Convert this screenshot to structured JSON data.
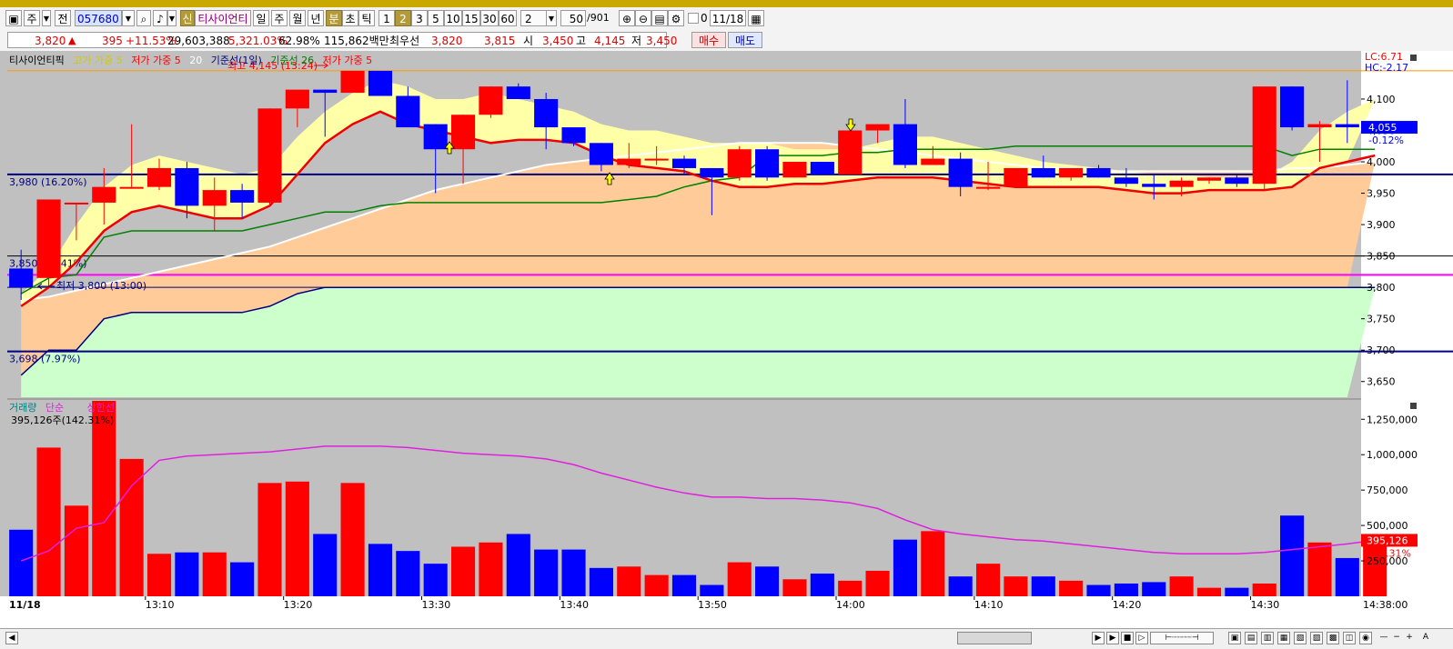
{
  "toolbar": {
    "period_label": "주",
    "prev_label": "전",
    "code": "057680",
    "new_badge": "신",
    "stock_name": "티사이언티",
    "periods": [
      "일",
      "주",
      "월",
      "년"
    ],
    "minute_label": "분",
    "second_label": "초",
    "tick_label": "틱",
    "intervals": [
      "1",
      "2",
      "3",
      "5",
      "10",
      "15",
      "30",
      "60"
    ],
    "active_interval": "2",
    "interval_select": "2",
    "count_value": "50",
    "count_total": "/901",
    "date_value": "11/18",
    "check_label": "0"
  },
  "quote": {
    "price": "3,820",
    "change_arrow": "▲",
    "change": "395",
    "change_pct": "+11.53%",
    "volume": "29,603,388",
    "volume_pct": "5,321.03%",
    "turnover_ratio": "62.98%",
    "amount": "115,862백만",
    "best_bid_label": "최우선",
    "best_ask": "3,820",
    "best_bid": "3,815",
    "open_label": "시",
    "open": "3,450",
    "high_label": "고",
    "high": "4,145",
    "low_label": "저",
    "low": "3,450",
    "buy_label": "매수",
    "sell_label": "매도"
  },
  "legend_top": {
    "name": "티사이언티픽",
    "high_ma": "고가 가중 5",
    "low_ma": "저가 가중 5",
    "ma20": "20",
    "base_line_day": "기준선(1일)",
    "base_line_26": "기준선 26",
    "low_ma2": "저가 가중 5"
  },
  "legend_vol": {
    "volume": "거래량",
    "simple": "단순",
    "upper_limit": "상한선",
    "volume_value": "395,126주(142.31%)"
  },
  "annotations": {
    "lc": "LC:6.71",
    "hc": "HC:-2.17",
    "high_marker": "최고 4,145 (13:24)",
    "low_marker": "최저 3,800 (13:00)",
    "line_3980": "3,980 (16.20%)",
    "line_3850": "3,850 (12.41%)",
    "line_3698": "3,698 (7.97%)",
    "current_price": "4,055",
    "current_pct": "-0.12%",
    "vol_current": "395,126",
    "vol_current_pct": "142.31%",
    "end_time": "14:38:00",
    "start_date": "11/18"
  },
  "colors": {
    "up": "#ff0000",
    "down": "#0000ff",
    "high_ma_fill": "#ffffa8",
    "cloud_fill": "#ffcc99",
    "green_fill": "#ccffcc",
    "base_line": "#008000",
    "ma20": "#ffffff",
    "vol_ma": "#e020e0"
  },
  "chart_data": {
    "type": "candlestick",
    "x": [
      "13:00",
      "13:02",
      "13:04",
      "13:06",
      "13:08",
      "13:10",
      "13:12",
      "13:14",
      "13:16",
      "13:18",
      "13:20",
      "13:22",
      "13:24",
      "13:26",
      "13:28",
      "13:30",
      "13:32",
      "13:34",
      "13:36",
      "13:38",
      "13:40",
      "13:42",
      "13:44",
      "13:46",
      "13:48",
      "13:50",
      "13:52",
      "13:54",
      "13:56",
      "13:58",
      "14:00",
      "14:02",
      "14:04",
      "14:06",
      "14:08",
      "14:10",
      "14:12",
      "14:14",
      "14:16",
      "14:18",
      "14:20",
      "14:22",
      "14:24",
      "14:26",
      "14:28",
      "14:30",
      "14:32",
      "14:34",
      "14:36",
      "14:38"
    ],
    "x_tick_labels": [
      "13:10",
      "13:20",
      "13:30",
      "13:40",
      "13:50",
      "14:00",
      "14:10",
      "14:20",
      "14:30"
    ],
    "ohlc": [
      [
        3830,
        3860,
        3780,
        3800
      ],
      [
        3815,
        3940,
        3800,
        3940
      ],
      [
        3935,
        3935,
        3875,
        3935
      ],
      [
        3935,
        3990,
        3900,
        3960
      ],
      [
        3960,
        4060,
        3960,
        3960
      ],
      [
        3960,
        4005,
        3955,
        3990
      ],
      [
        3990,
        4000,
        3910,
        3930
      ],
      [
        3930,
        3975,
        3890,
        3955
      ],
      [
        3955,
        3965,
        3910,
        3935
      ],
      [
        3935,
        4085,
        3930,
        4085
      ],
      [
        4085,
        4110,
        4055,
        4115
      ],
      [
        4115,
        4115,
        4040,
        4110
      ],
      [
        4110,
        4145,
        4110,
        4145
      ],
      [
        4145,
        4145,
        4105,
        4105
      ],
      [
        4105,
        4120,
        4060,
        4055
      ],
      [
        4060,
        4060,
        3950,
        4020
      ],
      [
        4020,
        4075,
        3965,
        4075
      ],
      [
        4075,
        4120,
        4070,
        4120
      ],
      [
        4120,
        4125,
        4100,
        4100
      ],
      [
        4100,
        4110,
        4020,
        4055
      ],
      [
        4055,
        4055,
        4025,
        4030
      ],
      [
        4030,
        4030,
        3985,
        3995
      ],
      [
        3995,
        4030,
        3990,
        4005
      ],
      [
        4005,
        4025,
        3995,
        4005
      ],
      [
        4005,
        4010,
        3980,
        3990
      ],
      [
        3990,
        3990,
        3915,
        3975
      ],
      [
        3975,
        4025,
        3970,
        4020
      ],
      [
        4020,
        4025,
        3970,
        3975
      ],
      [
        3975,
        4000,
        3975,
        4000
      ],
      [
        4000,
        4000,
        3980,
        3980
      ],
      [
        3980,
        4050,
        3980,
        4050
      ],
      [
        4050,
        4060,
        4030,
        4060
      ],
      [
        4060,
        4100,
        3990,
        3995
      ],
      [
        3995,
        4025,
        3995,
        4005
      ],
      [
        4005,
        4015,
        3945,
        3960
      ],
      [
        3960,
        4000,
        3955,
        3960
      ],
      [
        3960,
        3990,
        3960,
        3990
      ],
      [
        3990,
        4010,
        3975,
        3975
      ],
      [
        3975,
        3990,
        3970,
        3990
      ],
      [
        3990,
        3995,
        3975,
        3975
      ],
      [
        3975,
        3990,
        3960,
        3965
      ],
      [
        3965,
        3980,
        3940,
        3960
      ],
      [
        3960,
        3975,
        3945,
        3970
      ],
      [
        3970,
        3975,
        3965,
        3975
      ],
      [
        3975,
        3980,
        3960,
        3965
      ],
      [
        3965,
        4120,
        3955,
        4120
      ],
      [
        4120,
        4120,
        4050,
        4055
      ],
      [
        4055,
        4065,
        4000,
        4060
      ],
      [
        4060,
        4130,
        4030,
        4055
      ]
    ],
    "volume": [
      470000,
      1050000,
      640000,
      1380000,
      970000,
      300000,
      310000,
      310000,
      240000,
      800000,
      810000,
      440000,
      800000,
      370000,
      320000,
      230000,
      350000,
      380000,
      440000,
      330000,
      330000,
      200000,
      210000,
      150000,
      150000,
      80000,
      240000,
      210000,
      120000,
      160000,
      110000,
      180000,
      400000,
      460000,
      140000,
      230000,
      140000,
      140000,
      110000,
      80000,
      90000,
      100000,
      140000,
      60000,
      60000,
      90000,
      570000,
      380000,
      270000,
      395126
    ],
    "volume_ma": [
      250000,
      320000,
      480000,
      520000,
      780000,
      960000,
      990000,
      1000000,
      1010000,
      1020000,
      1040000,
      1060000,
      1060000,
      1060000,
      1050000,
      1030000,
      1010000,
      1000000,
      990000,
      970000,
      930000,
      870000,
      820000,
      770000,
      730000,
      700000,
      700000,
      690000,
      690000,
      680000,
      660000,
      620000,
      540000,
      470000,
      440000,
      420000,
      400000,
      390000,
      370000,
      350000,
      330000,
      310000,
      300000,
      300000,
      300000,
      310000,
      330000,
      350000,
      370000,
      395126
    ],
    "high_ma": [
      3790,
      3830,
      3900,
      3960,
      3995,
      4010,
      4000,
      3990,
      3980,
      3990,
      4040,
      4080,
      4110,
      4130,
      4120,
      4100,
      4100,
      4110,
      4100,
      4090,
      4080,
      4060,
      4050,
      4050,
      4040,
      4030,
      4030,
      4030,
      4020,
      4020,
      4020,
      4030,
      4040,
      4040,
      4030,
      4020,
      4010,
      4000,
      3995,
      3990,
      3985,
      3980,
      3980,
      3975,
      3975,
      3975,
      4000,
      4050,
      4080,
      4100
    ],
    "low_ma": [
      3770,
      3800,
      3840,
      3890,
      3920,
      3930,
      3920,
      3910,
      3910,
      3930,
      3980,
      4030,
      4060,
      4080,
      4060,
      4050,
      4040,
      4030,
      4035,
      4035,
      4030,
      4010,
      3995,
      3990,
      3985,
      3970,
      3960,
      3960,
      3965,
      3965,
      3970,
      3975,
      3975,
      3975,
      3970,
      3965,
      3960,
      3960,
      3960,
      3960,
      3955,
      3950,
      3950,
      3955,
      3955,
      3955,
      3960,
      3990,
      4000,
      4010
    ],
    "ma20": [
      3780,
      3785,
      3795,
      3805,
      3815,
      3825,
      3835,
      3845,
      3855,
      3865,
      3880,
      3895,
      3910,
      3925,
      3940,
      3955,
      3965,
      3975,
      3985,
      3995,
      4000,
      4005,
      4010,
      4015,
      4020,
      4025,
      4030,
      4030,
      4030,
      4030,
      4025,
      4020,
      4015,
      4010,
      4005,
      4000,
      3995,
      3990,
      3990,
      3985,
      3985,
      3985,
      3985,
      3985,
      3985,
      3985,
      3990,
      3990,
      3995,
      4000
    ],
    "base_line": [
      3660,
      3700,
      3700,
      3750,
      3760,
      3760,
      3760,
      3760,
      3760,
      3770,
      3790,
      3800,
      3800,
      3800,
      3800,
      3800,
      3800,
      3800,
      3800,
      3800,
      3800,
      3800,
      3800,
      3800,
      3800,
      3800,
      3800,
      3800,
      3800,
      3800,
      3800,
      3800,
      3800,
      3800,
      3800,
      3800,
      3800,
      3800,
      3800,
      3800,
      3800,
      3800,
      3800,
      3800,
      3800,
      3800,
      3800,
      3800,
      3800,
      3800
    ],
    "base_line_26": [
      3790,
      3815,
      3820,
      3880,
      3890,
      3890,
      3890,
      3890,
      3890,
      3900,
      3910,
      3920,
      3920,
      3930,
      3935,
      3935,
      3935,
      3935,
      3935,
      3935,
      3935,
      3935,
      3940,
      3945,
      3960,
      3970,
      3975,
      4010,
      4010,
      4010,
      4015,
      4015,
      4020,
      4020,
      4020,
      4020,
      4025,
      4025,
      4025,
      4025,
      4025,
      4025,
      4025,
      4025,
      4025,
      4025,
      4010,
      4020,
      4020,
      4020
    ],
    "horizontal_lines": [
      {
        "value": 4145,
        "label": ""
      },
      {
        "value": 3980,
        "label": "3,980 (16.20%)"
      },
      {
        "value": 3850,
        "label": "3,850 (12.41%)"
      },
      {
        "value": 3820,
        "label": ""
      },
      {
        "value": 3800,
        "label": ""
      },
      {
        "value": 3698,
        "label": "3,698 (7.97%)"
      }
    ],
    "price_ticks": [
      4100,
      4050,
      4000,
      3950,
      3900,
      3850,
      3800,
      3750,
      3700,
      3650
    ],
    "volume_ticks": [
      250000,
      500000,
      750000,
      1000000,
      1250000
    ],
    "volume_tick_labels": [
      "250,000",
      "500,000",
      "750,000",
      "1,000,000",
      "1,250,000"
    ],
    "ylim": [
      3625,
      4155
    ],
    "vol_ylim": [
      0,
      1380000
    ]
  }
}
